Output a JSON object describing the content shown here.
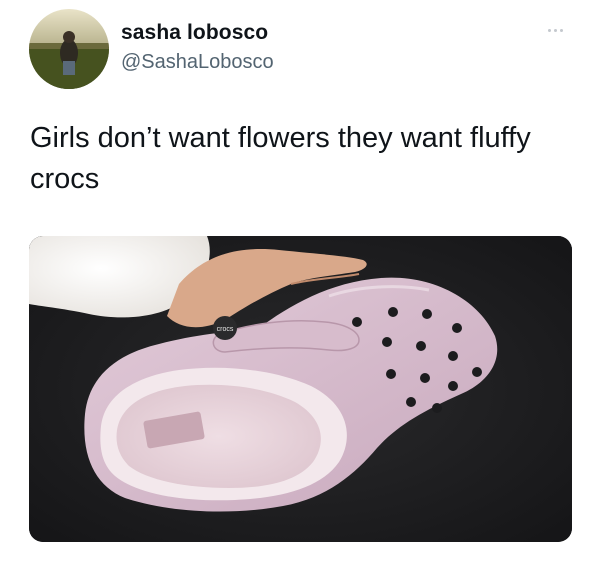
{
  "tweet": {
    "author": {
      "display_name": "sasha lobosco",
      "handle": "@SashaLobosco"
    },
    "more_icon": "ellipsis-icon",
    "text": "Girls don’t want flowers they want fluffy crocs",
    "media": {
      "alt_icon": "photo-crocs-clog",
      "logo_text": "crocs"
    }
  }
}
